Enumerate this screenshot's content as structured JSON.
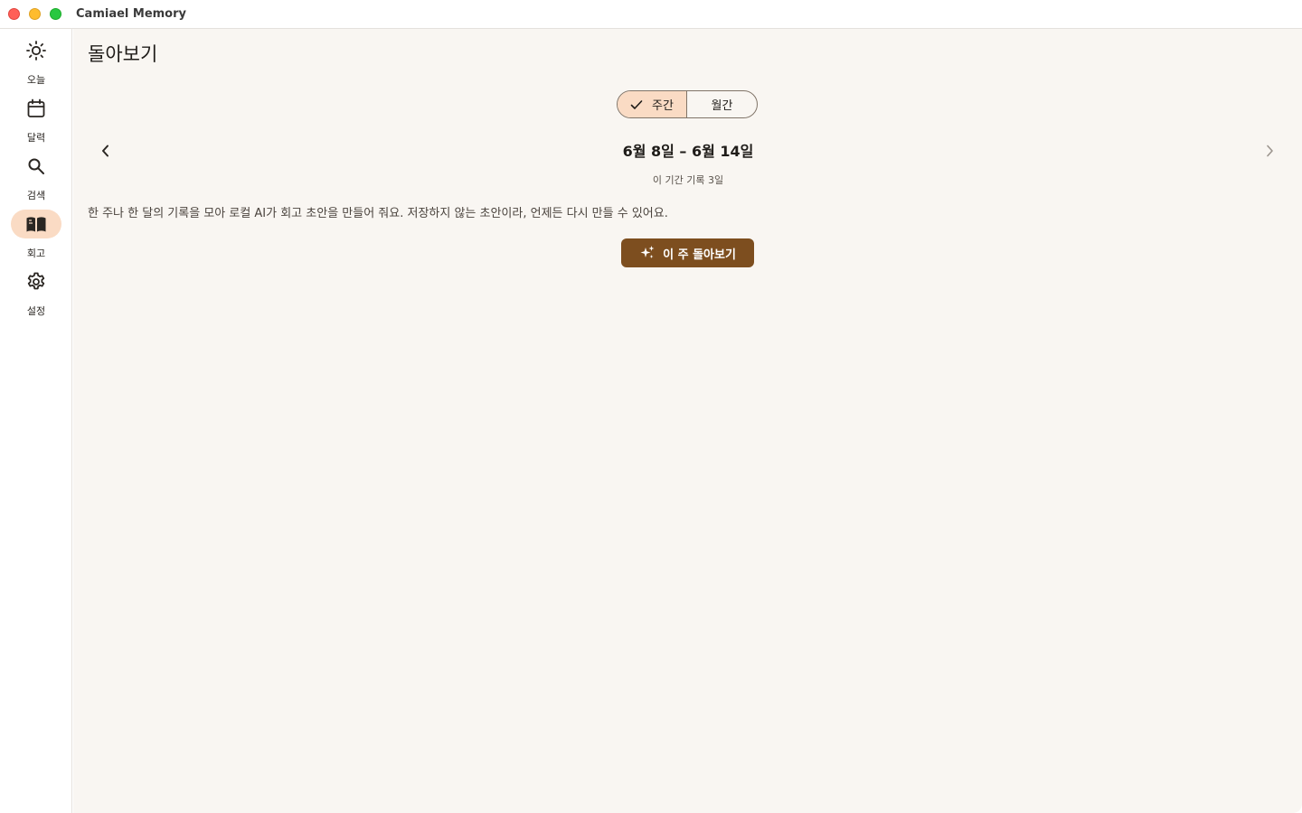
{
  "window": {
    "title": "Camiael Memory"
  },
  "sidebar": {
    "items": [
      {
        "label": "오늘",
        "icon": "sun-icon"
      },
      {
        "label": "달력",
        "icon": "calendar-icon"
      },
      {
        "label": "검색",
        "icon": "search-icon"
      },
      {
        "label": "회고",
        "icon": "book-icon",
        "active": true
      },
      {
        "label": "설정",
        "icon": "gear-icon"
      }
    ]
  },
  "main": {
    "title": "돌아보기",
    "segmented": {
      "options": [
        "주간",
        "월간"
      ],
      "selected": "주간"
    },
    "range": {
      "label": "6월 8일 – 6월 14일",
      "count": "이 기간 기록 3일"
    },
    "description": "한 주나 한 달의 기록을 모아 로컬 AI가 회고 초안을 만들어 줘요. 저장하지 않는 초안이라, 언제든 다시 만들 수 있어요.",
    "cta_label": "이 주 돌아보기"
  },
  "colors": {
    "accent": "#7d4e1f",
    "selected_bg": "#fadbc4",
    "main_bg": "#f9f6f2"
  }
}
